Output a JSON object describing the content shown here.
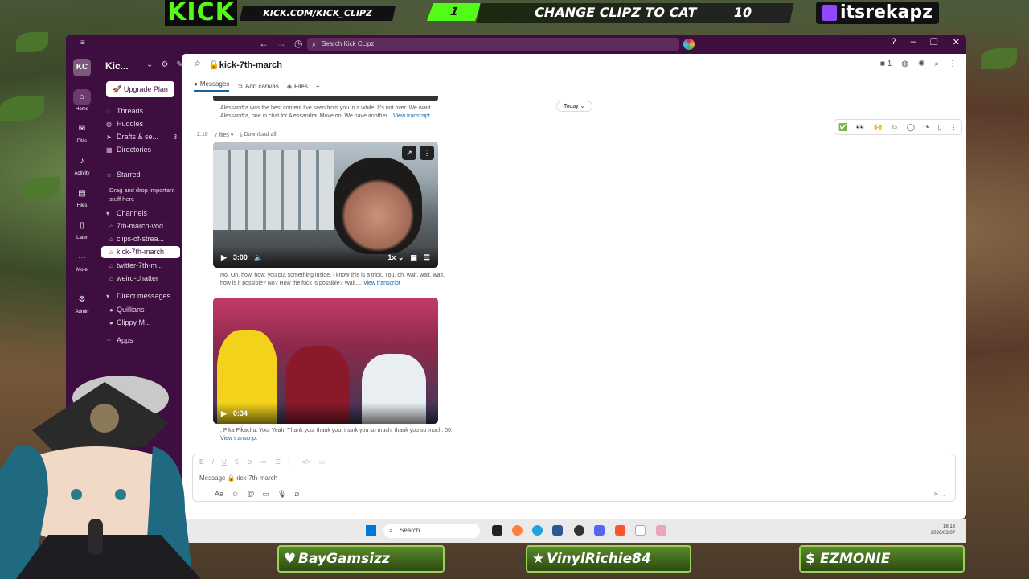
{
  "overlay": {
    "kick_logo": "KICK",
    "kick_url": "KICK.COM/KICK_CLIPZ",
    "goal_count": "1",
    "goal_text": "CHANGE CLIPZ TO CAT",
    "goal_target": "10",
    "twitch_name": "itsrekapz",
    "alerts": [
      {
        "icon": "heart-icon",
        "label": "BayGamsizz"
      },
      {
        "icon": "star-icon",
        "label": "VinylRichie84"
      },
      {
        "icon": "dollar-icon",
        "label": "EZMONIE"
      }
    ]
  },
  "titlebar": {
    "search_placeholder": "Search Kick CLipz"
  },
  "rail": {
    "workspace_initials": "KC",
    "items": [
      {
        "label": "Home"
      },
      {
        "label": "DMs"
      },
      {
        "label": "Activity"
      },
      {
        "label": "Files"
      },
      {
        "label": "Later"
      },
      {
        "label": "More"
      },
      {
        "label": "Admin"
      }
    ]
  },
  "sidebar": {
    "workspace_name": "Kic...",
    "upgrade_label": "Upgrade Plan",
    "threads": "Threads",
    "huddles": "Huddles",
    "drafts": "Drafts & se...",
    "drafts_count": "8",
    "directories": "Directories",
    "starred": "Starred",
    "starred_hint": "Drag and drop important stuff here",
    "channels_header": "Channels",
    "channels": [
      {
        "label": "7th-march-vod"
      },
      {
        "label": "clips-of-strea..."
      },
      {
        "label": "kick-7th-march"
      },
      {
        "label": "twitter-7th-m..."
      },
      {
        "label": "weird-chatter"
      }
    ],
    "dm_header": "Direct messages",
    "dms": [
      {
        "label": "Quillians"
      },
      {
        "label": "Clippy M..."
      }
    ],
    "apps": "Apps"
  },
  "channel": {
    "name": "kick-7th-march",
    "member_count": "1",
    "tabs": [
      {
        "label": "Messages"
      },
      {
        "label": "Add canvas"
      },
      {
        "label": "Files"
      }
    ],
    "today_label": "Today",
    "prev_transcript": "Alessandra was the best content I've seen from you in a while. It's not over. We want Alessandra, one in chat for Alessandra. Move on. We have another...",
    "view_transcript": "View transcript",
    "time": "2:10",
    "files_count": "7 files",
    "download_all": "Download all",
    "video1": {
      "duration": "3:00",
      "speed": "1x"
    },
    "transcript1": "No. Oh, how, how, you put something inside. I know this is a trick. You, oh, wait, wait, wait, how is it possible? No? How the fuck is possible? Wait,...",
    "video2": {
      "duration": "0:34"
    },
    "transcript2": ". Pika Pikachu. You. Yeah. Thank you, thank you, thank you so much, thank you so much. 00.",
    "composer_placeholder": "Message 🔒kick-7th-march"
  },
  "taskbar": {
    "search": "Search",
    "time": "18:13",
    "date": "2026/03/07"
  }
}
